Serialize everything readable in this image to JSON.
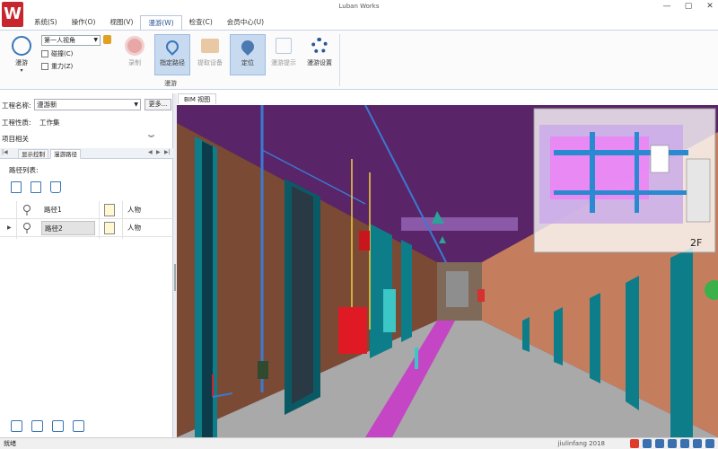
{
  "window": {
    "title": "Luban Works",
    "minimize": "—",
    "maximize": "▢",
    "close": "✕"
  },
  "logo": "W",
  "menu": [
    "系统(S)",
    "操作(O)",
    "视图(V)",
    "漫游(W)",
    "检查(C)",
    "会员中心(U)"
  ],
  "menu_active_index": 3,
  "ribbon": {
    "roam_label": "漫游",
    "view_mode": "第一人视角",
    "collision_label": "碰撞(C)",
    "gravity_label": "重力(Z)",
    "record_label": "录制",
    "set_path_label": "指定路径",
    "extract_device_label": "提取设备",
    "locate_label": "定位",
    "roam_hint_label": "漫游提示",
    "roam_settings_label": "漫游设置",
    "group_label": "漫游"
  },
  "left_panel": {
    "project_name_label": "工程名称:",
    "project_name_value": "漫游新",
    "more_button": "更多...",
    "project_nature_label": "工程性质:",
    "project_nature_value": "工作集",
    "project_related_label": "项目相关",
    "tab_display": "显示控制",
    "tab_path": "漫游路径",
    "path_list_label": "路径列表:",
    "paths": [
      {
        "name": "路径1",
        "type": "人物"
      },
      {
        "name": "路径2",
        "type": "人物"
      }
    ]
  },
  "viewport": {
    "tab_label": "BIM 视图",
    "floor_label": "2F"
  },
  "status": {
    "text": "就绪",
    "user": "jiulinfang 2018"
  },
  "colors": {
    "accent": "#2b5797",
    "logo": "#c8262e",
    "floor": "#a9a9a9",
    "pipe": "#3a7ad0",
    "ceiling": "#52215e"
  }
}
